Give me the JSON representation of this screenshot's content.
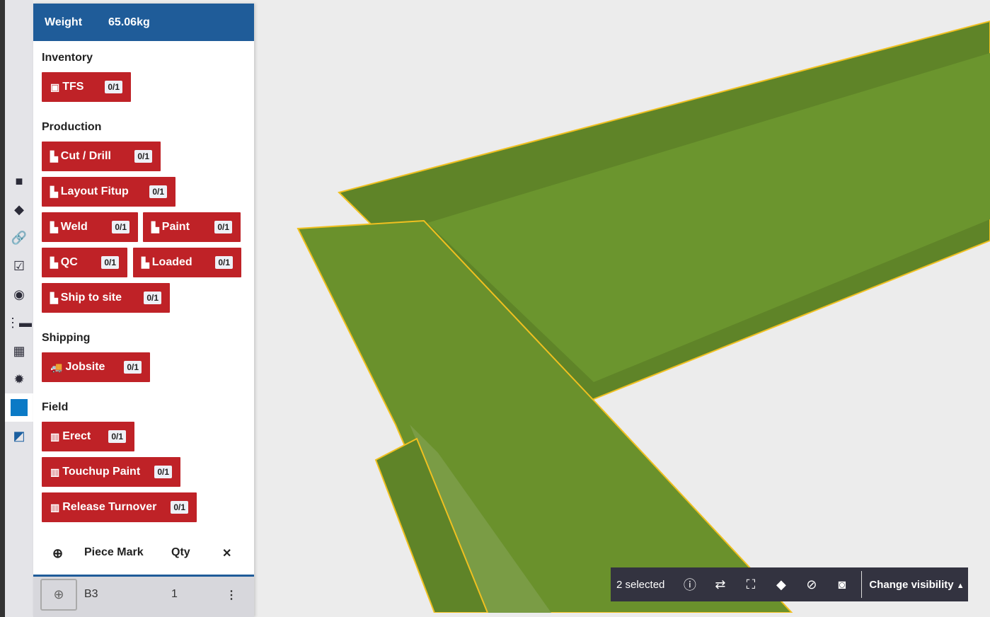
{
  "header": {
    "weight_label": "Weight",
    "weight_value": "65.06kg"
  },
  "sections": {
    "inventory": "Inventory",
    "production": "Production",
    "shipping": "Shipping",
    "field": "Field"
  },
  "buttons": {
    "tfs": {
      "label": "TFS",
      "count": "0/1"
    },
    "cut": {
      "label": "Cut / Drill",
      "count": "0/1"
    },
    "layout": {
      "label": "Layout Fitup",
      "count": "0/1"
    },
    "weld": {
      "label": "Weld",
      "count": "0/1"
    },
    "paint": {
      "label": "Paint",
      "count": "0/1"
    },
    "qc": {
      "label": "QC",
      "count": "0/1"
    },
    "loaded": {
      "label": "Loaded",
      "count": "0/1"
    },
    "ship": {
      "label": "Ship to site",
      "count": "0/1"
    },
    "jobsite": {
      "label": "Jobsite",
      "count": "0/1"
    },
    "erect": {
      "label": "Erect",
      "count": "0/1"
    },
    "touchup": {
      "label": "Touchup Paint",
      "count": "0/1"
    },
    "release": {
      "label": "Release Turnover",
      "count": "0/1"
    }
  },
  "table": {
    "headers": {
      "piece_mark": "Piece Mark",
      "qty": "Qty"
    },
    "rows": [
      {
        "piece_mark": "B3",
        "qty": "1"
      }
    ]
  },
  "toolbar": {
    "selected": "2 selected",
    "change_visibility": "Change visibility"
  },
  "colors": {
    "accent": "#1f5c99",
    "status_red": "#bf2227",
    "beam_green": "#6a912c"
  }
}
